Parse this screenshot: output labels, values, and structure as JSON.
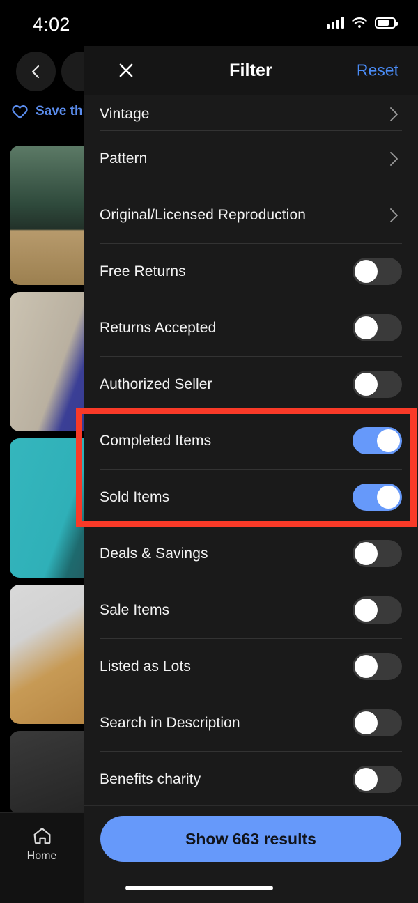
{
  "status_bar": {
    "time": "4:02",
    "icons": [
      "cellular-signal-icon",
      "wifi-icon",
      "battery-icon"
    ]
  },
  "background_page": {
    "back_icon": "chevron-left-icon",
    "save_search_icon": "heart-icon",
    "save_search_label": "Save this s",
    "thumbnails": [
      {
        "name": "listing-thumb-1",
        "description": "teal ceramic vase on wood"
      },
      {
        "name": "listing-thumb-2",
        "description": "blue embossed pottery vase on granite"
      },
      {
        "name": "listing-thumb-3",
        "description": "art pottery vase on teal background"
      },
      {
        "name": "listing-thumb-4",
        "description": "tan glazed stoneware bowl"
      }
    ],
    "bottom_tab": {
      "icon": "home-icon",
      "label": "Home"
    }
  },
  "filter": {
    "close_icon": "close-x-icon",
    "title": "Filter",
    "reset_label": "Reset",
    "rows": [
      {
        "label": "Vintage",
        "control": "chevron",
        "on": false
      },
      {
        "label": "Pattern",
        "control": "chevron",
        "on": false
      },
      {
        "label": "Original/Licensed Reproduction",
        "control": "chevron",
        "on": false
      },
      {
        "label": "Free Returns",
        "control": "toggle",
        "on": false
      },
      {
        "label": "Returns Accepted",
        "control": "toggle",
        "on": false
      },
      {
        "label": "Authorized Seller",
        "control": "toggle",
        "on": false
      },
      {
        "label": "Completed Items",
        "control": "toggle",
        "on": true
      },
      {
        "label": "Sold Items",
        "control": "toggle",
        "on": true
      },
      {
        "label": "Deals & Savings",
        "control": "toggle",
        "on": false
      },
      {
        "label": "Sale Items",
        "control": "toggle",
        "on": false
      },
      {
        "label": "Listed as Lots",
        "control": "toggle",
        "on": false
      },
      {
        "label": "Search in Description",
        "control": "toggle",
        "on": false
      },
      {
        "label": "Benefits charity",
        "control": "toggle",
        "on": false
      }
    ],
    "submit_label": "Show 663 results",
    "results_count": 663
  },
  "annotation": {
    "highlight_color": "#f93a28",
    "highlighted_rows": [
      "Completed Items",
      "Sold Items"
    ]
  },
  "colors": {
    "accent_blue": "#6699fa",
    "link_blue": "#4a8cf7",
    "modal_bg": "#1a1a1a",
    "header_bg": "#151515",
    "page_bg": "#000000",
    "toggle_off": "#3a3a3a",
    "divider": "#333333"
  }
}
